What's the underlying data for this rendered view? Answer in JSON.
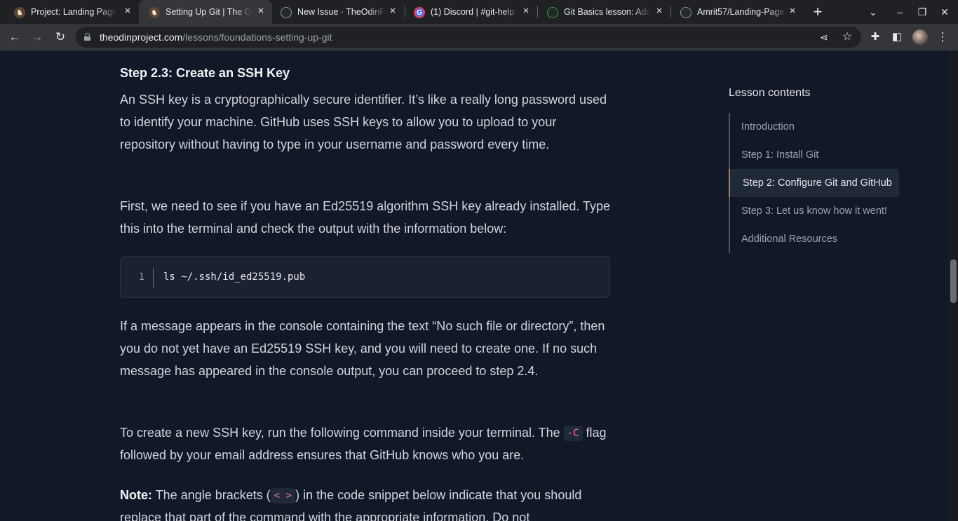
{
  "browser": {
    "tabs": [
      {
        "title": "Project: Landing Page | T",
        "favicon": "odin-icon",
        "active": false
      },
      {
        "title": "Setting Up Git | The Odin",
        "favicon": "odin-icon",
        "active": true
      },
      {
        "title": "New Issue · TheOdinProject",
        "favicon": "github-icon",
        "active": false
      },
      {
        "title": "(1) Discord | #git-help",
        "favicon": "discord-icon",
        "active": false
      },
      {
        "title": "Git Basics lesson: Add",
        "favicon": "github-icon",
        "active": false
      },
      {
        "title": "Amrit57/Landing-Page",
        "favicon": "github-icon",
        "active": false
      }
    ],
    "url_host": "theodinproject.com",
    "url_path": "/lessons/foundations-setting-up-git"
  },
  "article": {
    "heading": "Step 2.3: Create an SSH Key",
    "p1": "An SSH key is a cryptographically secure identifier. It’s like a really long password used to identify your machine. GitHub uses SSH keys to allow you to upload to your repository without having to type in your username and password every time.",
    "p2": "First, we need to see if you have an Ed25519 algorithm SSH key already installed. Type this into the terminal and check the output with the information below:",
    "code_line_number": "1",
    "code_line": "ls ~/.ssh/id_ed25519.pub",
    "p3": "If a message appears in the console containing the text “No such file or directory”, then you do not yet have an Ed25519 SSH key, and you will need to create one. If no such message has appeared in the console output, you can proceed to step 2.4.",
    "p4_before": "To create a new SSH key, run the following command inside your terminal. The",
    "p4_code": "-C",
    "p4_after": "flag followed by your email address ensures that GitHub knows who you are.",
    "p5_label": "Note:",
    "p5_before": "The angle brackets (",
    "p5_code": "< >",
    "p5_after": ") in the code snippet below indicate that you should replace that part of the command with the appropriate information. Do not"
  },
  "lesson_contents": {
    "title": "Lesson contents",
    "items": [
      {
        "label": "Introduction",
        "active": false
      },
      {
        "label": "Step 1: Install Git",
        "active": false
      },
      {
        "label": "Step 2: Configure Git and GitHub",
        "active": true
      },
      {
        "label": "Step 3: Let us know how it went!",
        "active": false
      },
      {
        "label": "Additional Resources",
        "active": false
      }
    ]
  },
  "colors": {
    "page_bg": "#111827",
    "accent": "#d97706",
    "inline_code": "#f472b6"
  }
}
